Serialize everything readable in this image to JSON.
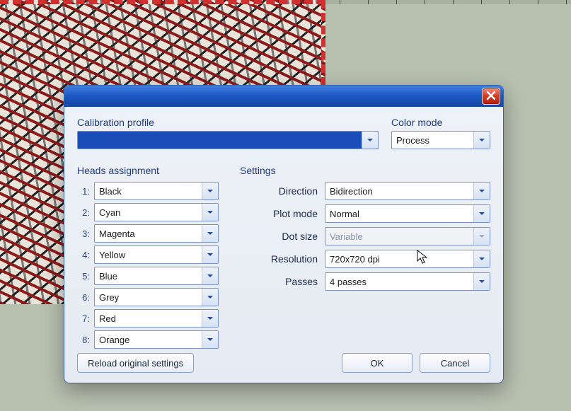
{
  "dialog": {
    "title": "",
    "calibration_profile": {
      "label": "Calibration profile",
      "value": ""
    },
    "color_mode": {
      "label": "Color mode",
      "value": "Process"
    },
    "heads": {
      "label": "Heads assignment",
      "items": [
        {
          "num": "1:",
          "value": "Black"
        },
        {
          "num": "2:",
          "value": "Cyan"
        },
        {
          "num": "3:",
          "value": "Magenta"
        },
        {
          "num": "4:",
          "value": "Yellow"
        },
        {
          "num": "5:",
          "value": "Blue"
        },
        {
          "num": "6:",
          "value": "Grey"
        },
        {
          "num": "7:",
          "value": "Red"
        },
        {
          "num": "8:",
          "value": "Orange"
        }
      ]
    },
    "settings": {
      "label": "Settings",
      "direction": {
        "label": "Direction",
        "value": "Bidirection"
      },
      "plot_mode": {
        "label": "Plot mode",
        "value": "Normal"
      },
      "dot_size": {
        "label": "Dot size",
        "value": "Variable",
        "disabled": true
      },
      "resolution": {
        "label": "Resolution",
        "value": "720x720 dpi"
      },
      "passes": {
        "label": "Passes",
        "value": "4 passes"
      }
    },
    "buttons": {
      "reload": "Reload original settings",
      "ok": "OK",
      "cancel": "Cancel"
    }
  }
}
